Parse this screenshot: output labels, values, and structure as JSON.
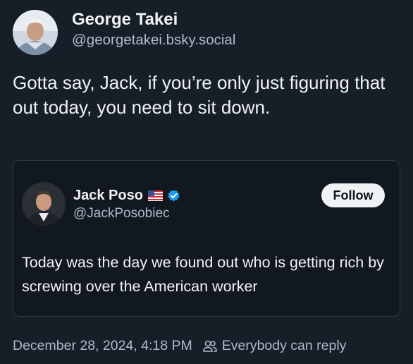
{
  "post": {
    "author": {
      "display_name": "George Takei",
      "handle": "@georgetakei.bsky.social"
    },
    "text": "Gotta say, Jack, if you’re only just figuring that out today, you need to sit down.",
    "timestamp": "December 28, 2024, 4:18 PM",
    "reply_setting": "Everybody can reply"
  },
  "quote": {
    "author": {
      "display_name": "Jack Poso",
      "handle": "@JackPosobiec"
    },
    "follow_label": "Follow",
    "text": "Today was the day we found out who is getting rich by screwing over the American worker"
  },
  "icons": {
    "flag": "us-flag-icon",
    "verified": "verified-badge-icon",
    "people": "people-icon"
  },
  "colors": {
    "background": "#161e27",
    "card_background": "#111820",
    "card_border": "#2e3a48",
    "text_primary": "#f1f3f5",
    "text_secondary": "#aebbc9",
    "verified": "#1d9bf0"
  }
}
